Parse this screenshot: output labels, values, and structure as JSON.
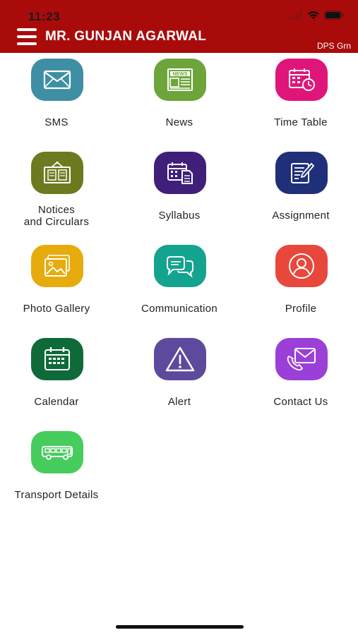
{
  "status_bar": {
    "time": "11:23",
    "icons": [
      "signal-icon",
      "wifi-icon",
      "battery-icon"
    ]
  },
  "header": {
    "title": "MR. GUNJAN AGARWAL",
    "subtitle": "DPS Grn",
    "menu_icon": "hamburger-menu-icon",
    "background": "#a90b0b"
  },
  "tiles": [
    {
      "label": "SMS",
      "icon": "envelope-icon",
      "color": "#3e8fa3"
    },
    {
      "label": "News",
      "icon": "newspaper-icon",
      "color": "#6ea53a"
    },
    {
      "label": "Time Table",
      "icon": "timetable-calendar-clock-icon",
      "color": "#e0157a"
    },
    {
      "label_line1": "Notices",
      "label_line2": "and Circulars",
      "icon": "notice-board-icon",
      "color": "#6e7a1f"
    },
    {
      "label": "Syllabus",
      "icon": "syllabus-calendar-document-icon",
      "color": "#3f1f7a"
    },
    {
      "label": "Assignment",
      "icon": "pen-document-icon",
      "color": "#1f2f7a"
    },
    {
      "label": "Photo Gallery",
      "icon": "photo-gallery-icon",
      "color": "#e6ac0e"
    },
    {
      "label": "Communication",
      "icon": "chat-bubbles-icon",
      "color": "#14a38e"
    },
    {
      "label": "Profile",
      "icon": "user-profile-icon",
      "color": "#e8473c"
    },
    {
      "label": "Calendar",
      "icon": "calendar-icon",
      "color": "#0f6a3a"
    },
    {
      "label": "Alert",
      "icon": "warning-triangle-icon",
      "color": "#5e4a9c"
    },
    {
      "label": "Contact Us",
      "icon": "envelope-phone-icon",
      "color": "#9b3fd9"
    },
    {
      "label": "Transport Details",
      "icon": "bus-icon",
      "color": "#47cc5e"
    }
  ]
}
